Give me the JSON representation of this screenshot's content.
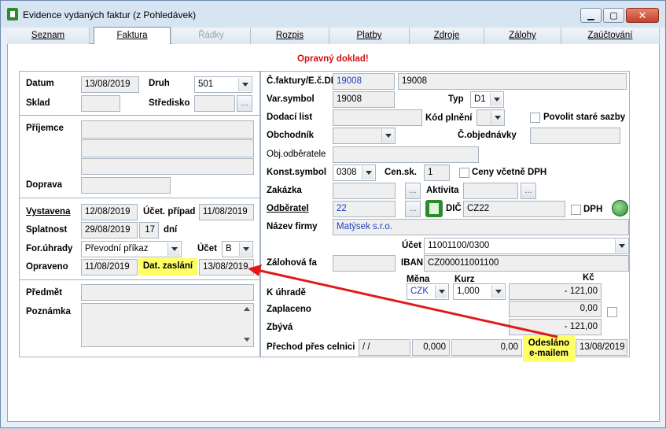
{
  "window": {
    "title": "Evidence vydaných faktur (z Pohledávek)",
    "minimize": "▁",
    "maximize": "▢",
    "close": "✕"
  },
  "tabs": [
    {
      "label": "Seznam"
    },
    {
      "label": "Faktura"
    },
    {
      "label": "Řádky"
    },
    {
      "label": "Rozpis"
    },
    {
      "label": "Platby"
    },
    {
      "label": "Zdroje"
    },
    {
      "label": "Zálohy"
    },
    {
      "label": "Zaúčtování"
    }
  ],
  "warning": "Opravný doklad!",
  "left": {
    "datum_label": "Datum",
    "datum": "13/08/2019",
    "druh_label": "Druh",
    "druh": "501",
    "sklad_label": "Sklad",
    "sklad": "",
    "stredisko_label": "Středisko",
    "stredisko": "",
    "prijemce_label": "Příjemce",
    "doprava_label": "Doprava",
    "vystavena_label": "Vystavena",
    "vystavena": "12/08/2019",
    "ucet_pripad_label": "Účet. případ",
    "ucet_pripad": "11/08/2019",
    "splatnost_label": "Splatnost",
    "splatnost": "29/08/2019",
    "splatnost_dni": "17",
    "dni_label": "dní",
    "for_uhrady_label": "For.úhrady",
    "for_uhrady": "Převodní příkaz",
    "ucet_label": "Účet",
    "ucet": "B",
    "opraveno_label": "Opraveno",
    "opraveno": "11/08/2019",
    "dat_zaslani_label": "Dat. zaslání",
    "dat_zaslani": "13/08/2019",
    "predmet_label": "Předmět",
    "poznamka_label": "Poznámka"
  },
  "right": {
    "cislo_label": "Č.faktury/E.č.DD",
    "cislo": "19008",
    "ec_dd": "19008",
    "var_symbol_label": "Var.symbol",
    "var_symbol": "19008",
    "typ_label": "Typ",
    "typ": "D1",
    "dodaci_list_label": "Dodací list",
    "kod_plneni_label": "Kód plnění",
    "povolit_label": "Povolit staré sazby",
    "obchodnik_label": "Obchodník",
    "c_objednavky_label": "Č.objednávky",
    "obj_odberatele_label": "Obj.odběratele",
    "konst_symbol_label": "Konst.symbol",
    "konst_symbol": "0308",
    "cen_sk_label": "Cen.sk.",
    "cen_sk": "1",
    "ceny_dph_label": "Ceny včetně DPH",
    "zakazka_label": "Zakázka",
    "aktivita_label": "Aktivita",
    "odberatel_label": "Odběratel",
    "odberatel": "22",
    "dic_label": "DIČ",
    "dic": "CZ22",
    "dph_label": "DPH",
    "nazev_firmy_label": "Název firmy",
    "nazev_firmy": "Matýsek s.r.o.",
    "ucet_label": "Účet",
    "ucet": "11001100/0300",
    "zalohova_fa_label": "Zálohová fa",
    "iban_label": "IBAN",
    "iban": "CZ000011001100",
    "mena_label": "Měna",
    "mena": "CZK",
    "kurz_label": "Kurz",
    "kurz": "1,000",
    "kc_label": "Kč",
    "k_uhrade_label": "K úhradě",
    "k_uhrade": "- 121,00",
    "zaplaceno_label": "Zaplaceno",
    "zaplaceno": "0,00",
    "zbyva_label": "Zbývá",
    "zbyva": "- 121,00",
    "prechod_label": "Přechod přes celnici",
    "prechod_date": "/ /",
    "prechod_val1": "0,000",
    "prechod_val2": "0,00",
    "odeslano_label_1": "Odesláno",
    "odeslano_label_2": "e-mailem",
    "odeslano": "13/08/2019"
  }
}
